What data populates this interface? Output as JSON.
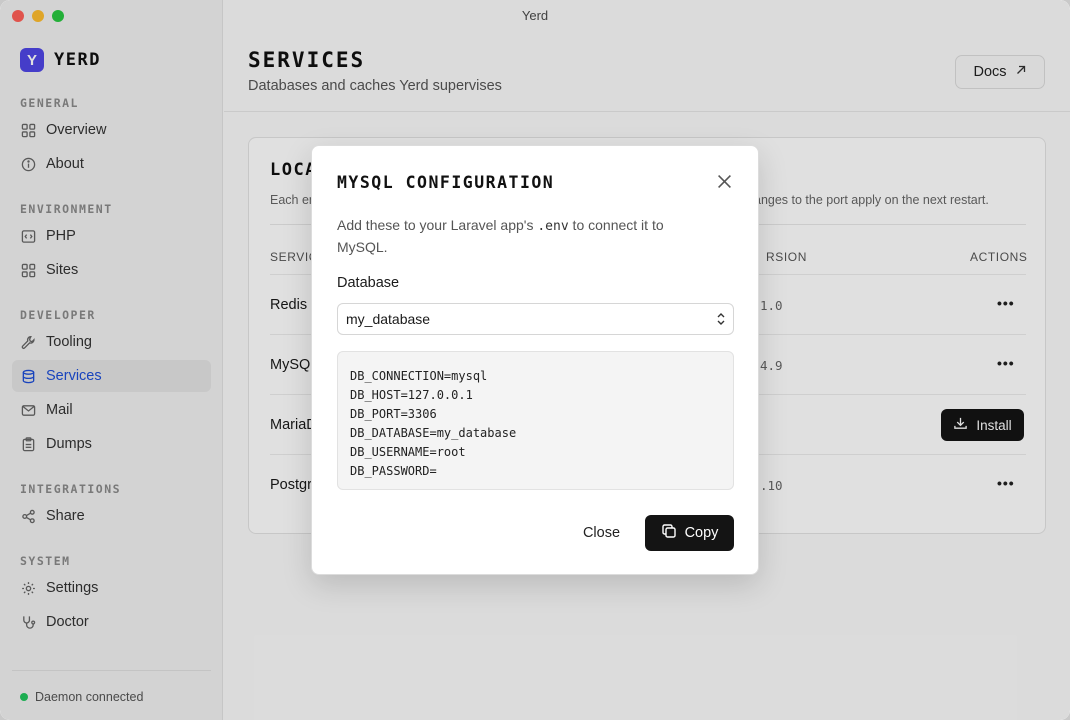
{
  "window": {
    "title": "Yerd"
  },
  "brand": {
    "logo_letter": "Y",
    "name": "YERD",
    "color": "#4f46e5"
  },
  "sidebar": {
    "sections": [
      {
        "label": "GENERAL",
        "items": [
          {
            "label": "Overview",
            "icon": "grid-icon"
          },
          {
            "label": "About",
            "icon": "info-icon"
          }
        ]
      },
      {
        "label": "ENVIRONMENT",
        "items": [
          {
            "label": "PHP",
            "icon": "code-icon"
          },
          {
            "label": "Sites",
            "icon": "grid-icon"
          }
        ]
      },
      {
        "label": "DEVELOPER",
        "items": [
          {
            "label": "Tooling",
            "icon": "wrench-icon"
          },
          {
            "label": "Services",
            "icon": "database-icon",
            "active": true
          },
          {
            "label": "Mail",
            "icon": "mail-icon"
          },
          {
            "label": "Dumps",
            "icon": "clipboard-icon"
          }
        ]
      },
      {
        "label": "INTEGRATIONS",
        "items": [
          {
            "label": "Share",
            "icon": "share-icon"
          }
        ]
      },
      {
        "label": "SYSTEM",
        "items": [
          {
            "label": "Settings",
            "icon": "gear-icon"
          },
          {
            "label": "Doctor",
            "icon": "stethoscope-icon"
          }
        ]
      }
    ],
    "status": {
      "text": "Daemon connected",
      "color": "#22c55e"
    }
  },
  "header": {
    "title": "SERVICES",
    "subtitle": "Databases and caches Yerd supervises",
    "docs_label": "Docs"
  },
  "card": {
    "title_visible": "LOCA",
    "desc_left_visible": "Each en",
    "desc_right_visible": "anges to the port apply on the next restart.",
    "columns": {
      "service_visible": "SERVIC",
      "version_visible": "RSION",
      "actions": "ACTIONS"
    },
    "rows": [
      {
        "name_visible": "Redis",
        "version_visible": "1.0",
        "action": "more"
      },
      {
        "name_visible": "MySQ",
        "version_visible": "4.9",
        "action": "more"
      },
      {
        "name_visible": "MariaD",
        "version_visible": "",
        "action": "install",
        "install_label": "Install"
      },
      {
        "name_visible": "Postgr",
        "version_visible": ".10",
        "action": "more"
      }
    ],
    "more_glyph": "•••"
  },
  "modal": {
    "title": "MYSQL CONFIGURATION",
    "desc_before": "Add these to your Laravel app's ",
    "desc_code": ".env",
    "desc_after": " to connect it to MySQL.",
    "database_label": "Database",
    "database_value": "my_database",
    "env_lines": [
      "DB_CONNECTION=mysql",
      "DB_HOST=127.0.0.1",
      "DB_PORT=3306",
      "DB_DATABASE=my_database",
      "DB_USERNAME=root",
      "DB_PASSWORD="
    ],
    "close_label": "Close",
    "copy_label": "Copy"
  }
}
